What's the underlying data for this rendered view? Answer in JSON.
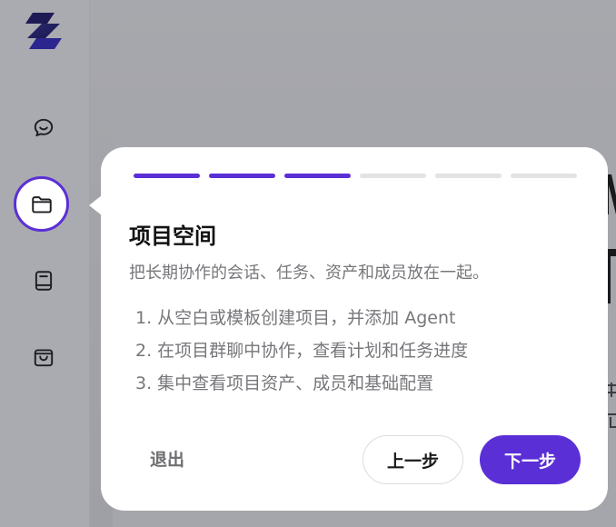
{
  "colors": {
    "accent": "#5b2fd6",
    "overlay_bg": "#9c9da3",
    "popover_bg": "#ffffff",
    "muted_text": "#77777b"
  },
  "sidebar": {
    "logo_icon": "brand-logo-icon",
    "items": [
      {
        "icon": "chat-icon",
        "active": false
      },
      {
        "icon": "folder-icon",
        "active": true
      },
      {
        "icon": "book-icon",
        "active": false
      },
      {
        "icon": "shopping-bag-icon",
        "active": false
      }
    ]
  },
  "tour": {
    "progress": {
      "total_steps": 6,
      "completed_steps": 3
    },
    "title": "项目空间",
    "subtitle": "把长期协作的会话、任务、资产和成员放在一起。",
    "steps": [
      "1. 从空白或模板创建项目，并添加 Agent",
      "2. 在项目群聊中协作，查看计划和任务进度",
      "3. 集中查看项目资产、成员和基础配置"
    ],
    "exit_label": "退出",
    "prev_label": "上一步",
    "next_label": "下一步"
  }
}
